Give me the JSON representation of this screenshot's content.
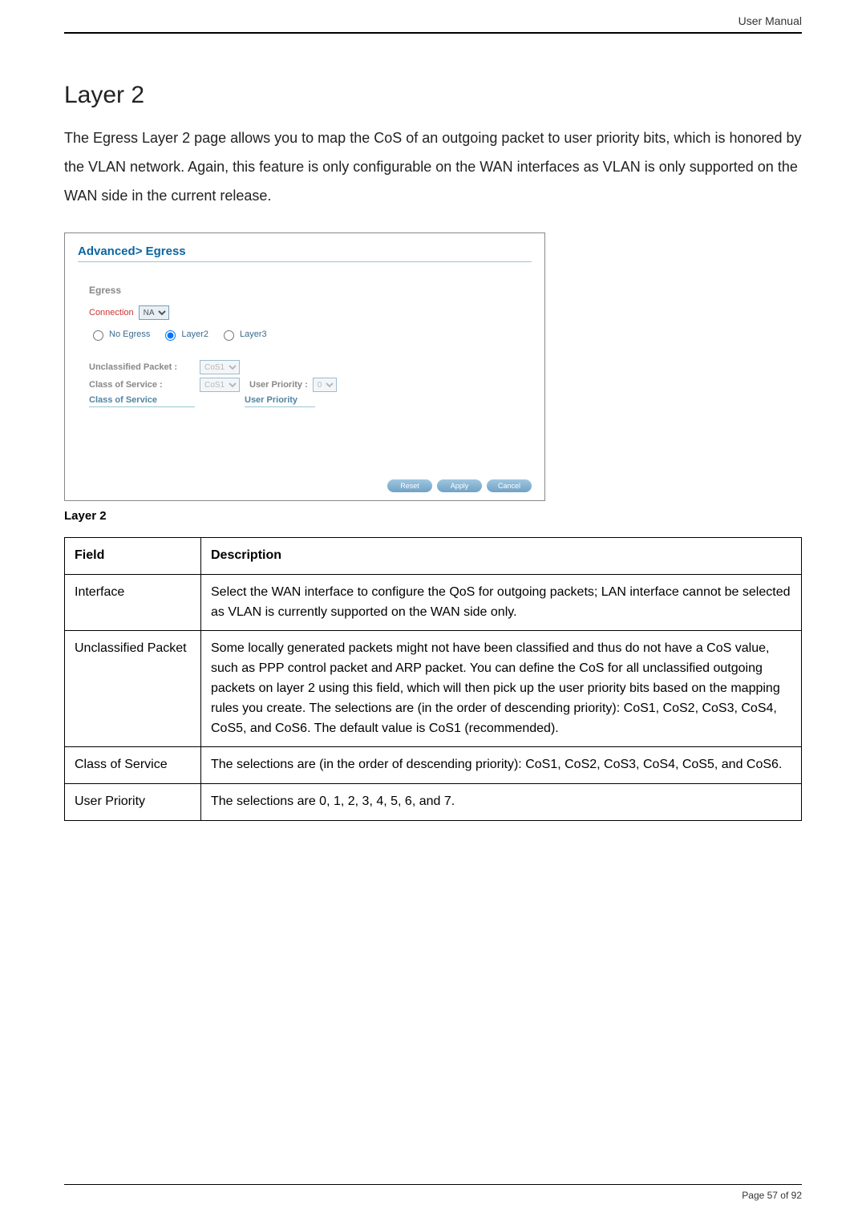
{
  "header": {
    "title": "User Manual"
  },
  "section": {
    "title": "Layer 2",
    "intro": "The Egress Layer 2 page allows you to map the CoS of an outgoing packet to user priority bits, which is honored by the VLAN network. Again, this feature is only configurable on the WAN interfaces as VLAN is only supported on the WAN side in the current release."
  },
  "shot": {
    "breadcrumb": "Advanced> Egress",
    "egress_label": "Egress",
    "connection_label": "Connection",
    "connection_value": "NA",
    "modes": {
      "no_egress": "No Egress",
      "layer2": "Layer2",
      "layer3": "Layer3",
      "selected": "layer2"
    },
    "unclassified_label": "Unclassified Packet :",
    "unclassified_value": "CoS1",
    "cos_label": "Class of Service :",
    "cos_value": "CoS1",
    "user_priority_label": "User Priority :",
    "user_priority_value": "0",
    "table_headers": {
      "cos": "Class of Service",
      "up": "User Priority"
    },
    "buttons": {
      "reset": "Reset",
      "apply": "Apply",
      "cancel": "Cancel"
    }
  },
  "caption": "Layer 2",
  "table": {
    "head_field": "Field",
    "head_desc": "Description",
    "rows": [
      {
        "field": "Interface",
        "desc": "Select the WAN interface to configure the QoS for outgoing packets; LAN interface cannot be selected as VLAN is currently supported on the WAN side only."
      },
      {
        "field": "Unclassified Packet",
        "desc": "Some locally generated packets might not have been classified and thus do not have a CoS value, such as PPP control packet and ARP packet. You can define the CoS for all unclassified outgoing packets on layer 2 using this field, which will then pick up the user priority bits based on the mapping rules you create. The selections are (in the order of descending priority): CoS1, CoS2, CoS3, CoS4, CoS5, and CoS6. The default value is CoS1 (recommended)."
      },
      {
        "field": "Class of Service",
        "desc": "The selections are (in the order of descending priority): CoS1, CoS2, CoS3, CoS4, CoS5, and CoS6."
      },
      {
        "field": "User Priority",
        "desc": "The selections are 0, 1, 2, 3, 4, 5, 6, and 7."
      }
    ]
  },
  "footer": {
    "page": "Page 57 of 92"
  }
}
